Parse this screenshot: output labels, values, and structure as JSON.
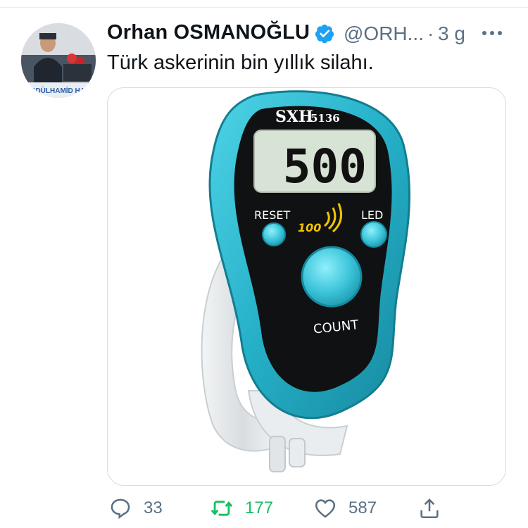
{
  "tweet": {
    "display_name": "Orhan OSMANOĞLU",
    "handle": "@ORH...",
    "separator": "·",
    "time": "3 g",
    "text": "Türk askerinin bin yıllık silahı."
  },
  "avatar": {
    "banner_text": "ABDÜLHAMİD HA"
  },
  "image": {
    "model_label": "SXH",
    "model_number": "5136",
    "display_value": "500",
    "reset_label": "RESET",
    "led_label": "LED",
    "sound_label": "100",
    "count_label": "COUNT"
  },
  "actions": {
    "replies": "33",
    "retweets": "177",
    "likes": "587"
  },
  "colors": {
    "link_gray": "#5b7083",
    "retweet_green": "#17bf63",
    "verified_blue": "#1da1f2",
    "device_teal": "#2ab5cc"
  }
}
